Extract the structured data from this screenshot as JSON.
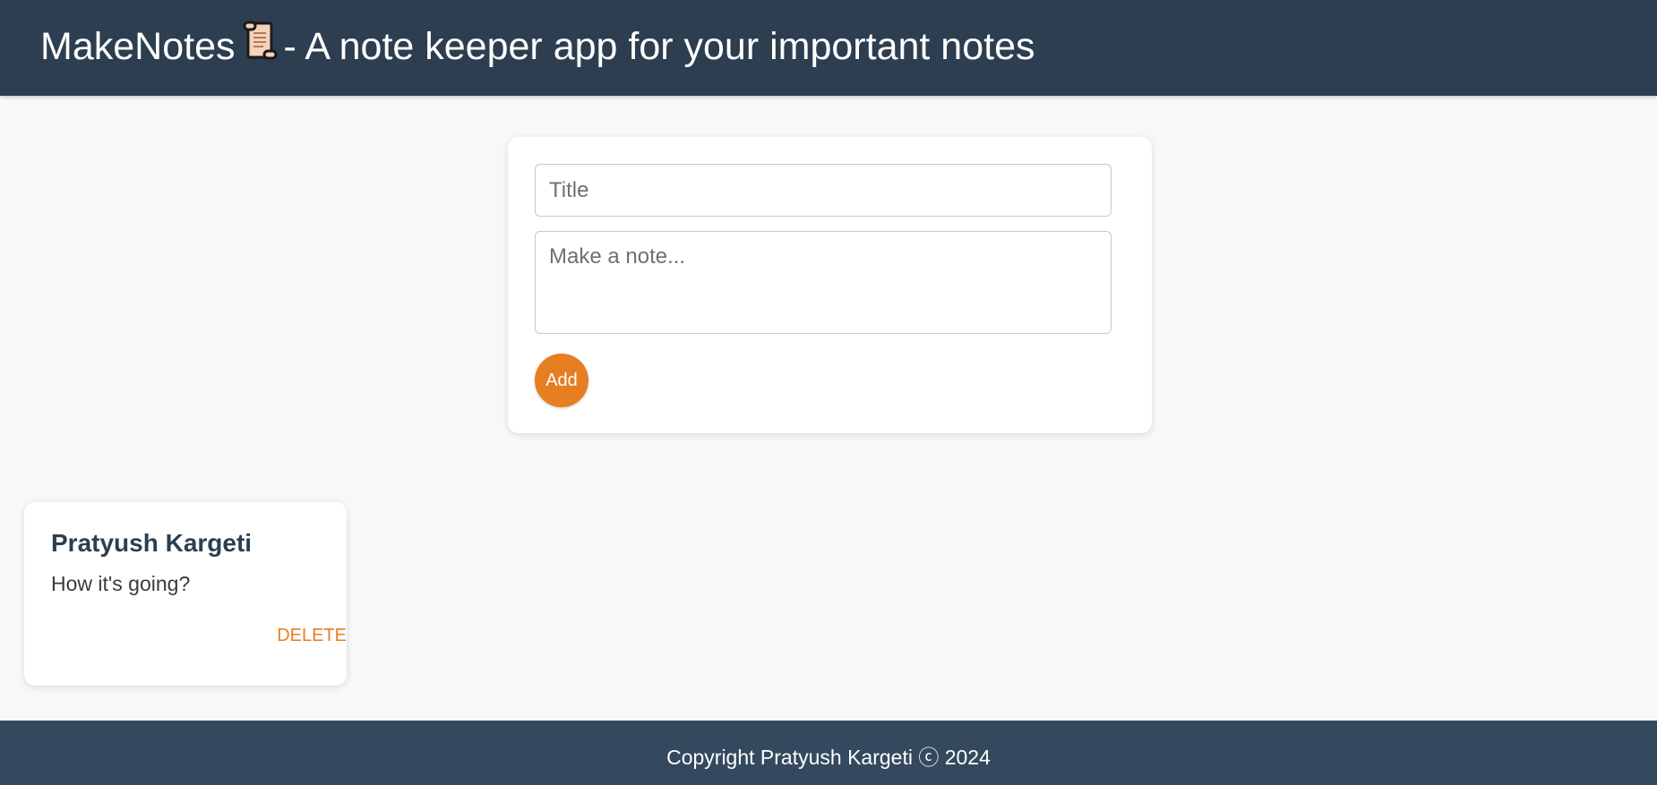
{
  "header": {
    "app_name": "MakeNotes",
    "icon": "scroll-icon",
    "tagline": "- A note keeper app for your important notes",
    "background": "#2c3e50"
  },
  "create_area": {
    "title_placeholder": "Title",
    "title_value": "",
    "content_placeholder": "Make a note...",
    "content_value": "",
    "add_label": "Add",
    "accent_color": "#e67e22"
  },
  "notes": [
    {
      "title": "Pratyush Kargeti",
      "content": "How it's going?",
      "delete_label": "DELETE"
    }
  ],
  "footer": {
    "text": "Copyright Pratyush Kargeti ⓒ 2024",
    "background": "#34495e"
  }
}
